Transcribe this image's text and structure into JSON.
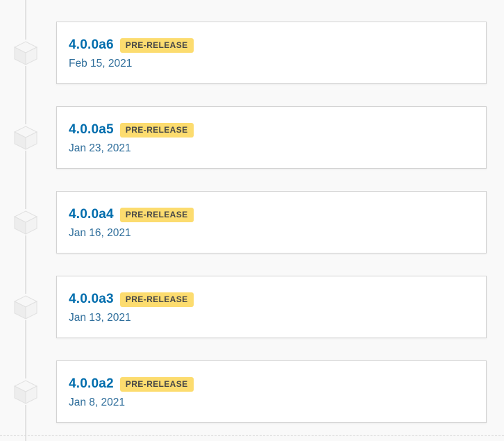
{
  "releases": [
    {
      "version": "4.0.0a6",
      "badge": "PRE-RELEASE",
      "date": "Feb 15, 2021",
      "icon": "package-cube-icon"
    },
    {
      "version": "4.0.0a5",
      "badge": "PRE-RELEASE",
      "date": "Jan 23, 2021",
      "icon": "package-cube-icon"
    },
    {
      "version": "4.0.0a4",
      "badge": "PRE-RELEASE",
      "date": "Jan 16, 2021",
      "icon": "package-cube-icon"
    },
    {
      "version": "4.0.0a3",
      "badge": "PRE-RELEASE",
      "date": "Jan 13, 2021",
      "icon": "package-cube-icon"
    },
    {
      "version": "4.0.0a2",
      "badge": "PRE-RELEASE",
      "date": "Jan 8, 2021",
      "icon": "package-cube-icon"
    }
  ],
  "colors": {
    "version_link": "#006dad",
    "date_text": "#2f6e9b",
    "badge_bg": "#fcdc6f",
    "timeline": "#e2e2e2"
  }
}
